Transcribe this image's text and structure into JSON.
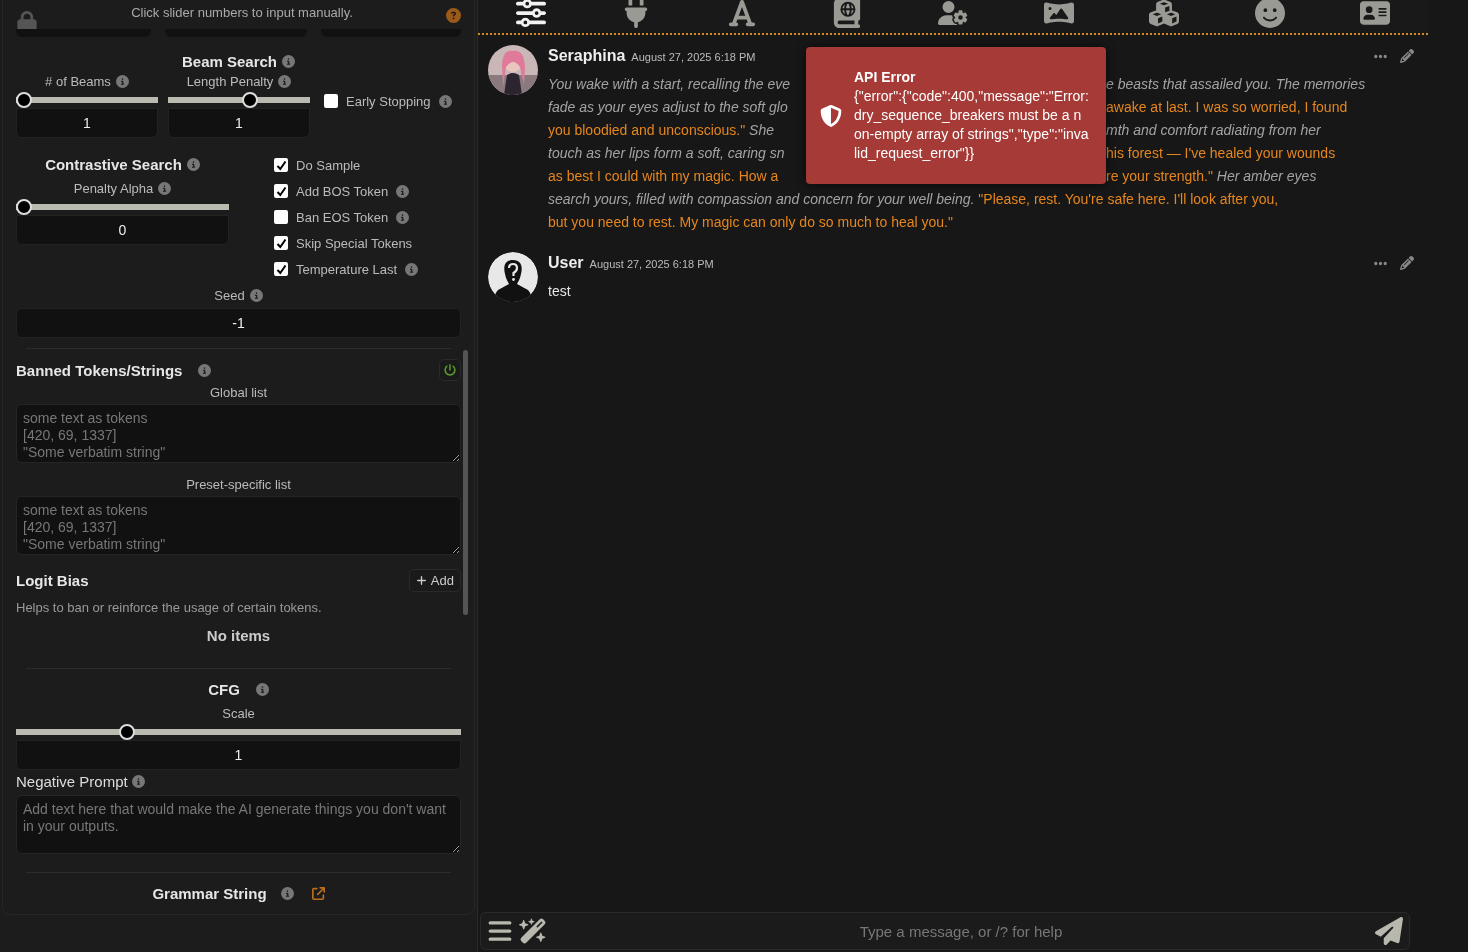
{
  "settings": {
    "hint": "Click slider numbers to input manually.",
    "beam_search": {
      "title": "Beam Search",
      "sliders": [
        {
          "label": "# of Beams",
          "value": "1",
          "level": 0
        },
        {
          "label": "Length Penalty",
          "value": "1",
          "level": 0.59
        }
      ],
      "early_stopping": {
        "label": "Early Stopping",
        "checked": false
      }
    },
    "contrastive_search": {
      "title": "Contrastive Search",
      "slider": {
        "label": "Penalty Alpha",
        "value": "0",
        "level": 0
      }
    },
    "checkboxes": [
      {
        "label": "Do Sample",
        "checked": true,
        "info": false
      },
      {
        "label": "Add BOS Token",
        "checked": true,
        "info": true
      },
      {
        "label": "Ban EOS Token",
        "checked": false,
        "info": true
      },
      {
        "label": "Skip Special Tokens",
        "checked": true,
        "info": false
      },
      {
        "label": "Temperature Last",
        "checked": true,
        "info": true
      }
    ],
    "seed": {
      "label": "Seed",
      "value": "-1"
    },
    "banned": {
      "title": "Banned Tokens/Strings",
      "enabled": true,
      "lists": [
        {
          "label": "Global list",
          "placeholder": "some text as tokens\n[420, 69, 1337]\n\"Some verbatim string\""
        },
        {
          "label": "Preset-specific list",
          "placeholder": "some text as tokens\n[420, 69, 1337]\n\"Some verbatim string\""
        }
      ]
    },
    "logit_bias": {
      "title": "Logit Bias",
      "add_label": "Add",
      "description": "Helps to ban or reinforce the usage of certain tokens.",
      "empty": "No items"
    },
    "cfg": {
      "title": "CFG",
      "slider": {
        "label": "Scale",
        "value": "1",
        "level": 0.24
      },
      "negative_prompt": {
        "label": "Negative Prompt",
        "placeholder": "Add text here that would make the AI generate things you don't want in your outputs."
      }
    },
    "grammar": {
      "title": "Grammar String"
    }
  },
  "nav": [
    {
      "kind": "sliders",
      "selected": true
    },
    {
      "kind": "plug",
      "selected": false
    },
    {
      "kind": "font",
      "selected": false
    },
    {
      "kind": "book",
      "selected": false
    },
    {
      "kind": "user-gear",
      "selected": false
    },
    {
      "kind": "panorama",
      "selected": false
    },
    {
      "kind": "cubes",
      "selected": false
    },
    {
      "kind": "smile",
      "selected": false
    },
    {
      "kind": "card",
      "selected": false
    }
  ],
  "messages": [
    {
      "author": "Seraphina",
      "kind": "picture",
      "time": "August 27, 2025 6:18 PM",
      "lines": [
        {
          "left": [
            {
              "kind": "narration",
              "text": "You wake with a start, recalling the eve"
            }
          ],
          "right": [
            {
              "kind": "narration",
              "text": "e beasts that assailed you. The memories"
            }
          ]
        },
        {
          "left": [
            {
              "kind": "narration",
              "text": "fade as your eyes adjust to the soft glo"
            }
          ],
          "right": [
            {
              "kind": "speech",
              "text": "awake at last. I was so worried, I found"
            }
          ]
        },
        {
          "left": [
            {
              "kind": "speech",
              "text": "you bloodied and unconscious.\""
            },
            {
              "kind": "narration",
              "text": " She"
            }
          ],
          "right": [
            {
              "kind": "narration",
              "text": "mth and comfort radiating from her"
            }
          ]
        },
        {
          "left": [
            {
              "kind": "narration",
              "text": "touch as her lips form a soft, caring sn"
            }
          ],
          "right": [
            {
              "kind": "speech",
              "text": "his forest — I've healed your wounds"
            }
          ]
        },
        {
          "left": [
            {
              "kind": "speech",
              "text": "as best I could with my magic. How a"
            }
          ],
          "right": [
            {
              "kind": "speech",
              "text": "re your strength.\""
            },
            {
              "kind": "narration",
              "text": " Her amber eyes"
            }
          ]
        },
        {
          "left": [
            {
              "kind": "narration",
              "text": "search yours, filled with compassion and concern for your well being. "
            },
            {
              "kind": "speech",
              "text": "\"Please, rest. You're safe here. I'll look after you,"
            }
          ]
        },
        {
          "left": [
            {
              "kind": "speech",
              "text": "but you need to rest. My magic can only do so much to heal you.\""
            }
          ]
        }
      ]
    },
    {
      "author": "User",
      "kind": "silhouette",
      "time": "August 27, 2025 6:18 PM",
      "lines": [
        {
          "left": [
            {
              "kind": "plain",
              "text": "test"
            }
          ]
        }
      ]
    }
  ],
  "toast": {
    "title": "API Error",
    "message": "{\"error\":{\"code\":400,\"message\":\"Error: dry_sequence_breakers must be a non-empty array of strings\",\"type\":\"invalid_request_error\"}}"
  },
  "input": {
    "placeholder": "Type a message, or /? for help"
  }
}
